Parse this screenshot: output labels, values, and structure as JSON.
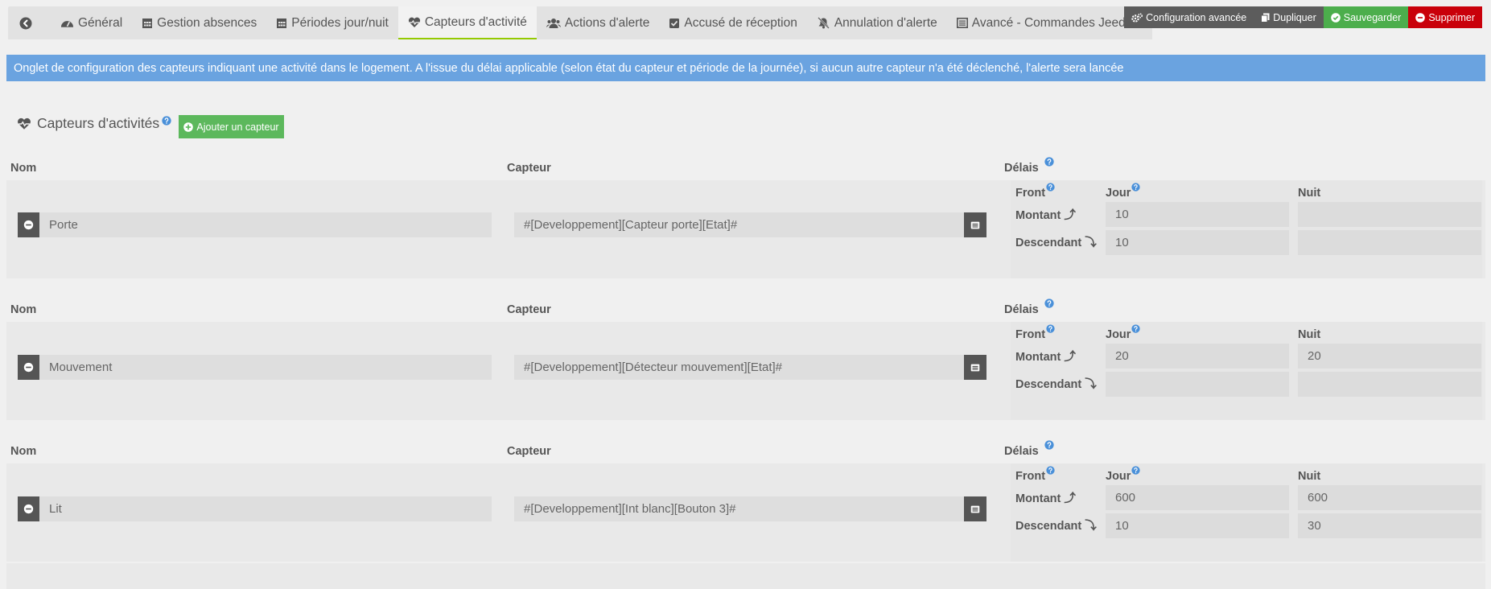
{
  "tabs": [
    {
      "label": "Général",
      "icon": "dashboard-icon"
    },
    {
      "label": "Gestion absences",
      "icon": "calendar-icon"
    },
    {
      "label": "Périodes jour/nuit",
      "icon": "calendar-icon"
    },
    {
      "label": "Capteurs d'activité",
      "icon": "heartbeat-icon",
      "active": true
    },
    {
      "label": "Actions d'alerte",
      "icon": "users-icon"
    },
    {
      "label": "Accusé de réception",
      "icon": "check-square-icon"
    },
    {
      "label": "Annulation d'alerte",
      "icon": "bell-slash-icon"
    },
    {
      "label": "Avancé - Commandes Jeedom",
      "icon": "list-alt-icon"
    }
  ],
  "actions": {
    "config": "Configuration avancée",
    "duplicate": "Dupliquer",
    "save": "Sauvegarder",
    "delete": "Supprimer"
  },
  "info_alert": "Onglet de configuration des capteurs indiquant une activité dans le logement. A l'issue du délai applicable (selon état du capteur et période de la journée), si aucun autre capteur n'a été déclenché, l'alerte sera lancée",
  "section": {
    "title": "Capteurs d'activités",
    "add_button": "Ajouter un capteur"
  },
  "labels": {
    "nom": "Nom",
    "capteur": "Capteur",
    "delais": "Délais",
    "front": "Front",
    "jour": "Jour",
    "nuit": "Nuit",
    "montant": "Montant",
    "descendant": "Descendant"
  },
  "sensors": [
    {
      "name": "Porte",
      "capteur": "#[Developpement][Capteur porte][Etat]#",
      "montant_jour": "10",
      "montant_nuit": "",
      "descendant_jour": "10",
      "descendant_nuit": ""
    },
    {
      "name": "Mouvement",
      "capteur": "#[Developpement][Détecteur mouvement][Etat]#",
      "montant_jour": "20",
      "montant_nuit": "20",
      "descendant_jour": "",
      "descendant_nuit": ""
    },
    {
      "name": "Lit",
      "capteur": "#[Developpement][Int blanc][Bouton 3]#",
      "montant_jour": "600",
      "montant_nuit": "600",
      "descendant_jour": "10",
      "descendant_nuit": "30"
    }
  ],
  "colors": {
    "alert_bg": "#6aa3e0",
    "save": "#4cae4c",
    "delete": "#c9000a",
    "add": "#5cb85c",
    "active_tab_border": "#94ca02"
  }
}
